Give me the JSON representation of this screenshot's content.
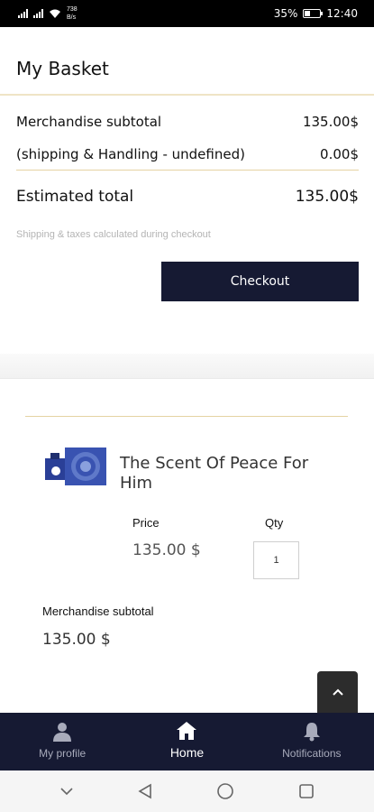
{
  "status_bar": {
    "network_speed": "738 B/s",
    "battery": "35%",
    "time": "12:40"
  },
  "header": {
    "title": "My Basket"
  },
  "summary": {
    "merchandise_label": "Merchandise subtotal",
    "merchandise_value": "135.00$",
    "shipping_label": "(shipping & Handling - undefined)",
    "shipping_value": "0.00$",
    "total_label": "Estimated total",
    "total_value": "135.00$",
    "note": "Shipping & taxes calculated during checkout",
    "checkout_label": "Checkout"
  },
  "item": {
    "name": "The Scent Of Peace For Him",
    "price_label": "Price",
    "price_value": "135.00 $",
    "qty_label": "Qty",
    "qty_value": "1",
    "subtotal_label": "Merchandise subtotal",
    "subtotal_value": "135.00 $"
  },
  "tabbar": {
    "tabs": [
      {
        "label": "My profile",
        "icon": "person-icon",
        "active": false
      },
      {
        "label": "Home",
        "icon": "home-icon",
        "active": true
      },
      {
        "label": "Notifications",
        "icon": "bell-icon",
        "active": false
      }
    ]
  },
  "colors": {
    "navy": "#161a33",
    "gold_divider": "#e5d3a3",
    "note_gray": "#b4b4b4"
  }
}
